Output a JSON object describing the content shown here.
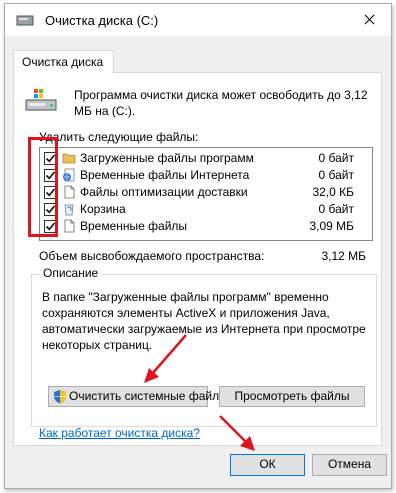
{
  "window": {
    "title": "Очистка диска  (C:)"
  },
  "tab": {
    "label": "Очистка диска"
  },
  "intro": {
    "text": "Программа очистки диска может освободить до 3,12 МБ на (C:)."
  },
  "files": {
    "label": "Удалить следующие файлы:",
    "items": [
      {
        "name": "Загруженные файлы программ",
        "size": "0 байт",
        "checked": true,
        "icon": "folder-icon"
      },
      {
        "name": "Временные файлы Интернета",
        "size": "0 байт",
        "checked": true,
        "icon": "internet-files-icon"
      },
      {
        "name": "Файлы оптимизации доставки",
        "size": "32,0 КБ",
        "checked": true,
        "icon": "document-icon"
      },
      {
        "name": "Корзина",
        "size": "0 байт",
        "checked": true,
        "icon": "recycle-bin-icon"
      },
      {
        "name": "Временные файлы",
        "size": "3,09 МБ",
        "checked": true,
        "icon": "document-icon"
      }
    ]
  },
  "space": {
    "label": "Объем высвобождаемого пространства:",
    "value": "3,12 МБ"
  },
  "description": {
    "title": "Описание",
    "text": "В папке \"Загруженные файлы программ\" временно сохраняются элементы ActiveX и приложения Java, автоматически загружаемые из Интернета при просмотре некоторых страниц."
  },
  "buttons": {
    "clean_system": "Очистить системные файлы",
    "view_files": "Просмотреть файлы",
    "ok": "ОК",
    "cancel": "Отмена"
  },
  "help_link": "Как работает очистка диска?",
  "colors": {
    "highlight": "#e0141e",
    "link": "#0066cc",
    "default_button_border": "#0078d7"
  }
}
